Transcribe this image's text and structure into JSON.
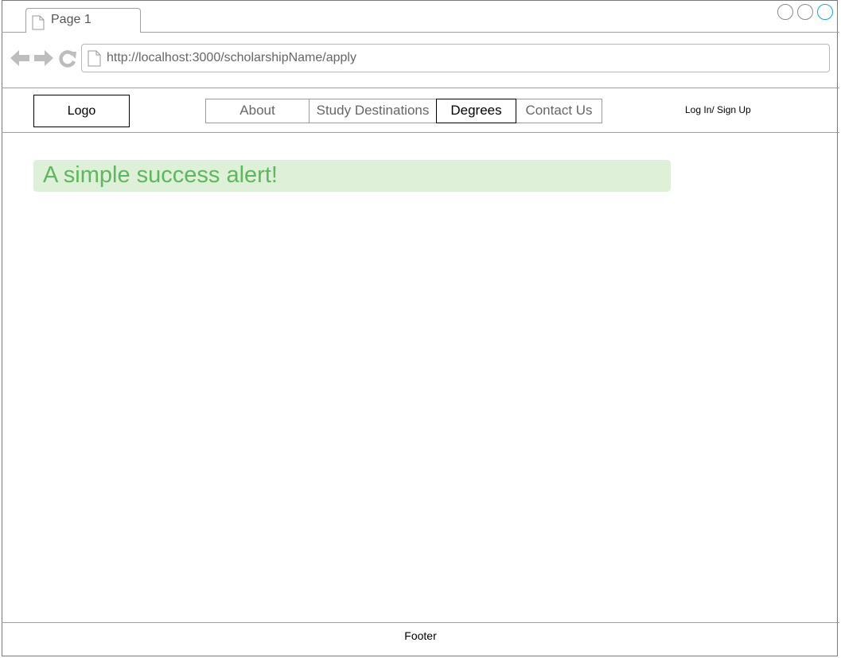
{
  "browser": {
    "tab": {
      "label": "Page 1",
      "icon": "document-icon"
    },
    "window_controls": [
      "circle",
      "circle",
      "circle"
    ],
    "nav_icons": [
      "back-arrow-icon",
      "forward-arrow-icon",
      "reload-icon"
    ],
    "address": {
      "url": "http://localhost:3000/scholarshipName/apply",
      "icon": "document-icon"
    }
  },
  "header": {
    "logo": "Logo",
    "menu": [
      {
        "label": "About",
        "active": false
      },
      {
        "label": "Study Destinations",
        "active": false
      },
      {
        "label": "Degrees",
        "active": true
      },
      {
        "label": "Contact Us",
        "active": false
      }
    ],
    "login": "Log In/ Sign Up"
  },
  "alert": {
    "text": "A simple success alert!",
    "background": "#dff0d8",
    "color": "#5cb85c"
  },
  "footer": {
    "text": "Footer"
  },
  "colors": {
    "accent": "#1ba1e2",
    "border": "#a0a0a0"
  }
}
